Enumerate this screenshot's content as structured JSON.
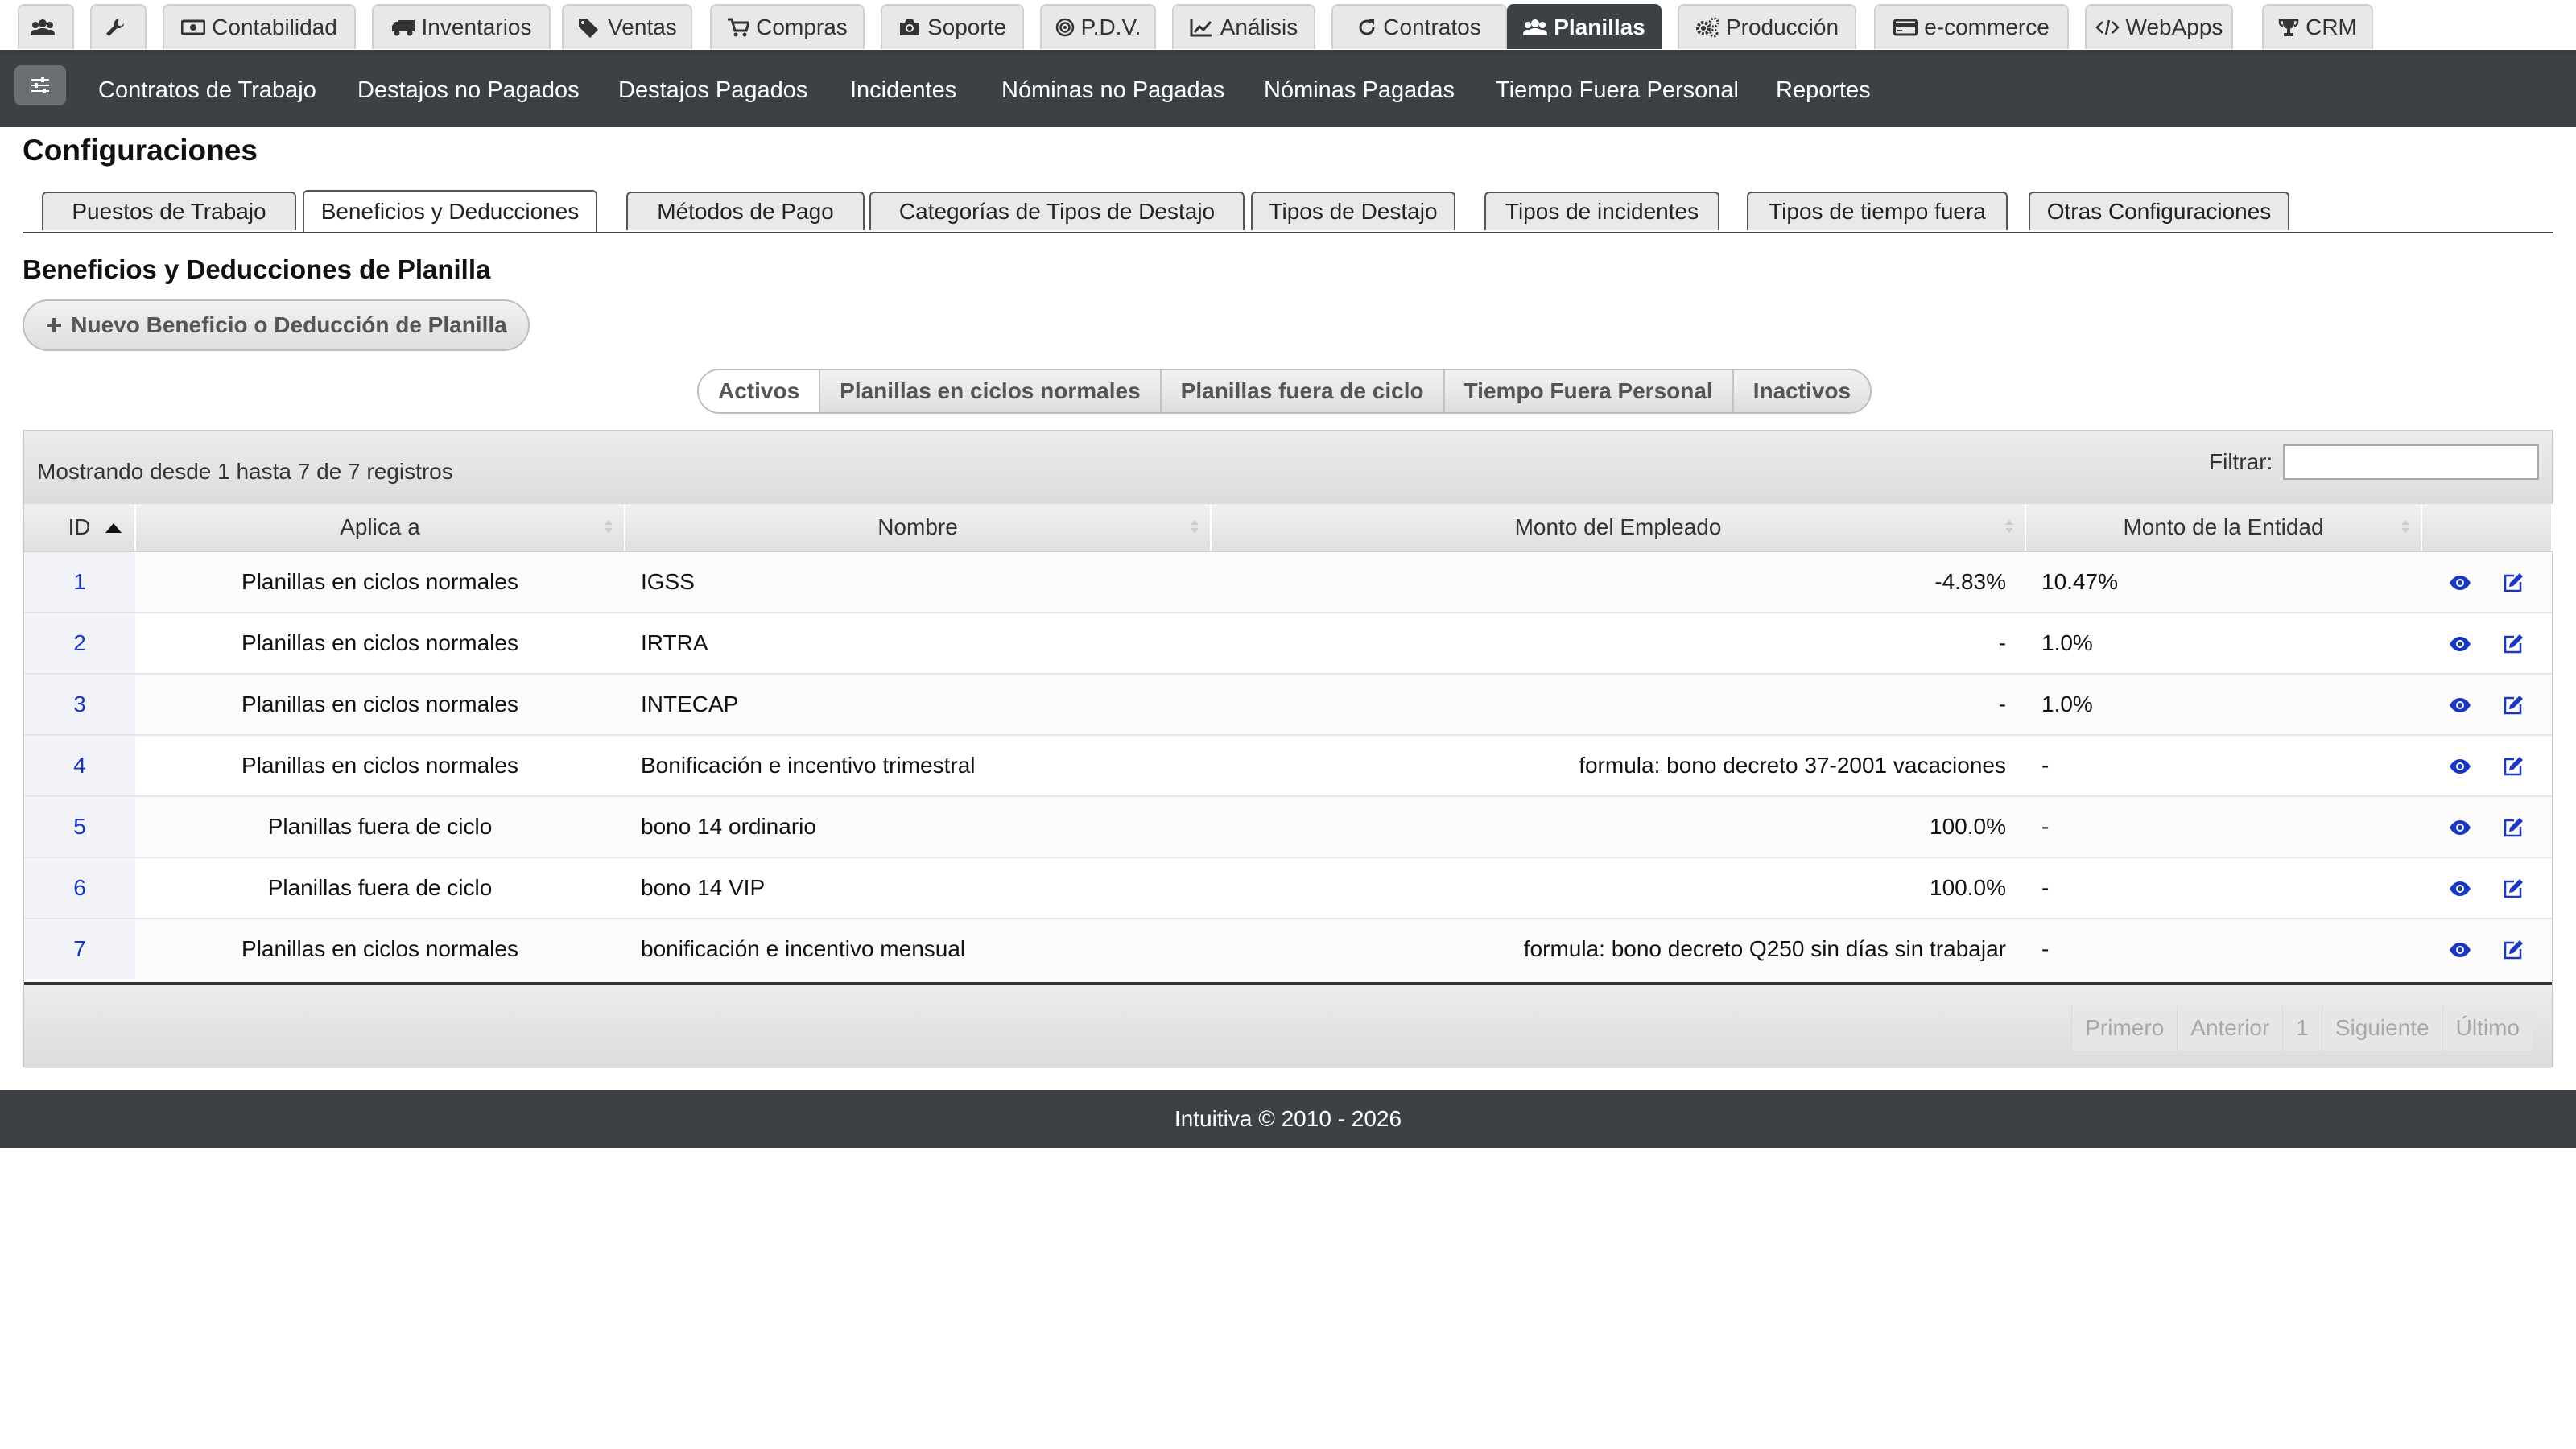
{
  "top_tabs": [
    {
      "label": "",
      "icon": "users-icon",
      "active": false
    },
    {
      "label": "",
      "icon": "wrench-icon",
      "active": false
    },
    {
      "label": "Contabilidad",
      "icon": "money-icon",
      "active": false
    },
    {
      "label": "Inventarios",
      "icon": "truck-icon",
      "active": false
    },
    {
      "label": "Ventas",
      "icon": "tags-icon",
      "active": false
    },
    {
      "label": "Compras",
      "icon": "cart-icon",
      "active": false
    },
    {
      "label": "Soporte",
      "icon": "camera-icon",
      "active": false
    },
    {
      "label": "P.D.V.",
      "icon": "target-icon",
      "active": false
    },
    {
      "label": "Análisis",
      "icon": "chart-line-icon",
      "active": false
    },
    {
      "label": "Contratos",
      "icon": "refresh-icon",
      "active": false
    },
    {
      "label": "Planillas",
      "icon": "users-icon",
      "active": true
    },
    {
      "label": "Producción",
      "icon": "gears-icon",
      "active": false
    },
    {
      "label": "e-commerce",
      "icon": "credit-card-icon",
      "active": false
    },
    {
      "label": "WebApps",
      "icon": "code-icon",
      "active": false
    },
    {
      "label": "CRM",
      "icon": "trophy-icon",
      "active": false
    }
  ],
  "subnav": {
    "toggle_icon": "sliders-icon",
    "items": [
      "Contratos de Trabajo",
      "Destajos no Pagados",
      "Destajos Pagados",
      "Incidentes",
      "Nóminas no Pagadas",
      "Nóminas Pagadas",
      "Tiempo Fuera Personal",
      "Reportes"
    ]
  },
  "page_title": "Configuraciones",
  "config_tabs": [
    {
      "label": "Puestos de Trabajo",
      "active": false
    },
    {
      "label": "Beneficios y Deducciones",
      "active": true
    },
    {
      "label": "Métodos de Pago",
      "active": false
    },
    {
      "label": "Categorías de Tipos de Destajo",
      "active": false
    },
    {
      "label": "Tipos de Destajo",
      "active": false
    },
    {
      "label": "Tipos de incidentes",
      "active": false
    },
    {
      "label": "Tipos de tiempo fuera",
      "active": false
    },
    {
      "label": "Otras Configuraciones",
      "active": false
    }
  ],
  "section_title": "Beneficios y Deducciones de Planilla",
  "new_button": {
    "label": "Nuevo Beneficio o Deducción de Planilla",
    "icon": "plus-icon"
  },
  "filter_pills": [
    "Activos",
    "Planillas en ciclos normales",
    "Planillas fuera de ciclo",
    "Tiempo Fuera Personal",
    "Inactivos"
  ],
  "table": {
    "records_info": "Mostrando desde 1 hasta 7 de 7 registros",
    "filter_label": "Filtrar:",
    "filter_value": "",
    "columns": [
      "ID",
      "Aplica a",
      "Nombre",
      "Monto del Empleado",
      "Monto de la Entidad",
      ""
    ],
    "rows": [
      {
        "id": "1",
        "aplica": "Planillas en ciclos normales",
        "nombre": "IGSS",
        "empleado": "-4.83%",
        "entidad": "10.47%"
      },
      {
        "id": "2",
        "aplica": "Planillas en ciclos normales",
        "nombre": "IRTRA",
        "empleado": "-",
        "entidad": "1.0%"
      },
      {
        "id": "3",
        "aplica": "Planillas en ciclos normales",
        "nombre": "INTECAP",
        "empleado": "-",
        "entidad": "1.0%"
      },
      {
        "id": "4",
        "aplica": "Planillas en ciclos normales",
        "nombre": "Bonificación e incentivo trimestral",
        "empleado": "formula: bono decreto 37-2001 vacaciones",
        "entidad": "-"
      },
      {
        "id": "5",
        "aplica": "Planillas fuera de ciclo",
        "nombre": "bono 14 ordinario",
        "empleado": "100.0%",
        "entidad": "-"
      },
      {
        "id": "6",
        "aplica": "Planillas fuera de ciclo",
        "nombre": "bono 14 VIP",
        "empleado": "100.0%",
        "entidad": "-"
      },
      {
        "id": "7",
        "aplica": "Planillas en ciclos normales",
        "nombre": "bonificación e incentivo mensual",
        "empleado": "formula: bono decreto Q250 sin días sin trabajar",
        "entidad": "-"
      }
    ],
    "row_actions": [
      "eye-icon",
      "edit-icon"
    ],
    "pager": [
      "Primero",
      "Anterior",
      "1",
      "Siguiente",
      "Último"
    ]
  },
  "footer": "Intuitiva © 2010 - 2026",
  "colors": {
    "dark_bar": "#3d4145",
    "link_blue": "#1a37c4"
  }
}
